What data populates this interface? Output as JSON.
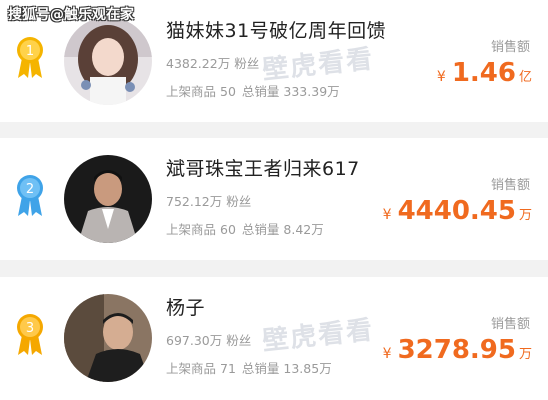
{
  "watermark": "搜狐号@触乐观在家",
  "site_watermark": "壁虎看看",
  "sales_label": "销售额",
  "fans_suffix": "粉丝",
  "shelf_label": "上架商品",
  "total_label": "总销量",
  "currency": "¥",
  "rankings": [
    {
      "rank": "1",
      "name": "猫妹妹31号破亿周年回馈",
      "fans": "4382.22万",
      "products": "50",
      "total_sales": "333.39万",
      "amount": "1.46",
      "unit": "亿",
      "medal_color": "#f5b400",
      "ribbon_color": "#f5b400"
    },
    {
      "rank": "2",
      "name": "斌哥珠宝王者归来617",
      "fans": "752.12万",
      "products": "60",
      "total_sales": "8.42万",
      "amount": "4440.45",
      "unit": "万",
      "medal_color": "#3fa3e8",
      "ribbon_color": "#3fa3e8"
    },
    {
      "rank": "3",
      "name": "杨子",
      "fans": "697.30万",
      "products": "71",
      "total_sales": "13.85万",
      "amount": "3278.95",
      "unit": "万",
      "medal_color": "#f5a800",
      "ribbon_color": "#f5a800"
    }
  ],
  "colors": {
    "accent": "#f06a1f",
    "muted": "#9a9a9a",
    "title": "#222222"
  }
}
